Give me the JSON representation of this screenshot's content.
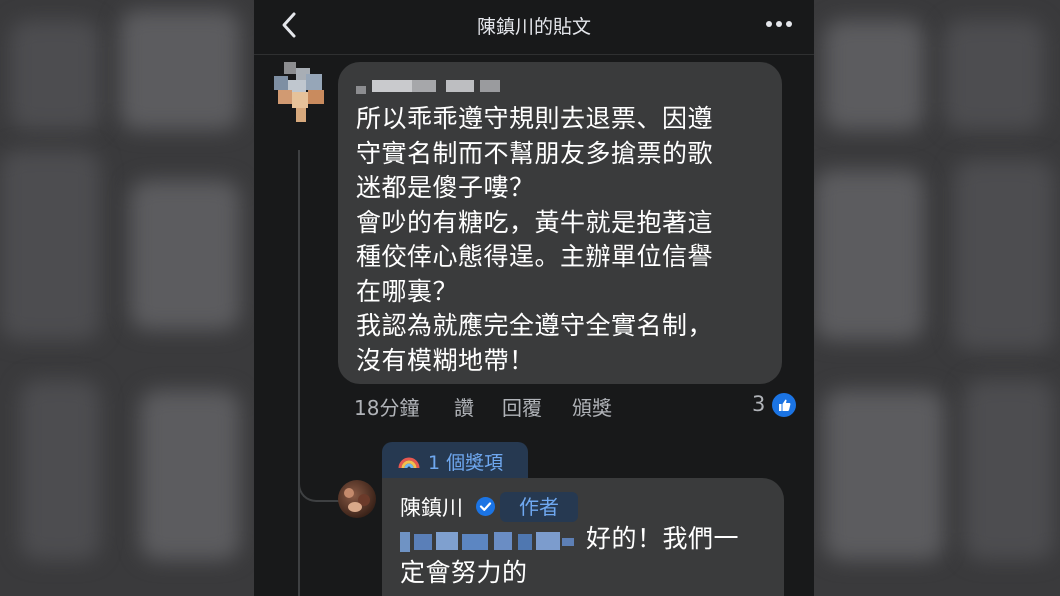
{
  "header": {
    "title": "陳鎮川的貼文"
  },
  "comment": {
    "lines": [
      "所以乖乖遵守規則去退票、因遵",
      "守實名制而不幫朋友多搶票的歌",
      "迷都是傻子嘍？",
      "會吵的有糖吃，黃牛就是抱著這",
      "種佼倖心態得逞。主辦單位信譽",
      "在哪裏？",
      "我認為就應完全遵守全實名制，",
      "沒有模糊地帶！"
    ],
    "time": "18分鐘",
    "like_label": "讚",
    "reply_label": "回覆",
    "award_label": "頒獎",
    "like_count": "3"
  },
  "award_badge": {
    "label": "1 個獎項"
  },
  "reply": {
    "author": "陳鎮川",
    "author_tag": "作者",
    "lines": [
      "好的！我們一",
      "定會努力的"
    ]
  },
  "colors": {
    "background": "#18191a",
    "bubble": "#3a3b3c",
    "accent": "#1b74e4",
    "secondary_text": "#b0b3b8"
  },
  "icons": [
    "back-icon",
    "more-icon",
    "like-icon",
    "verified-icon",
    "award-icon"
  ]
}
